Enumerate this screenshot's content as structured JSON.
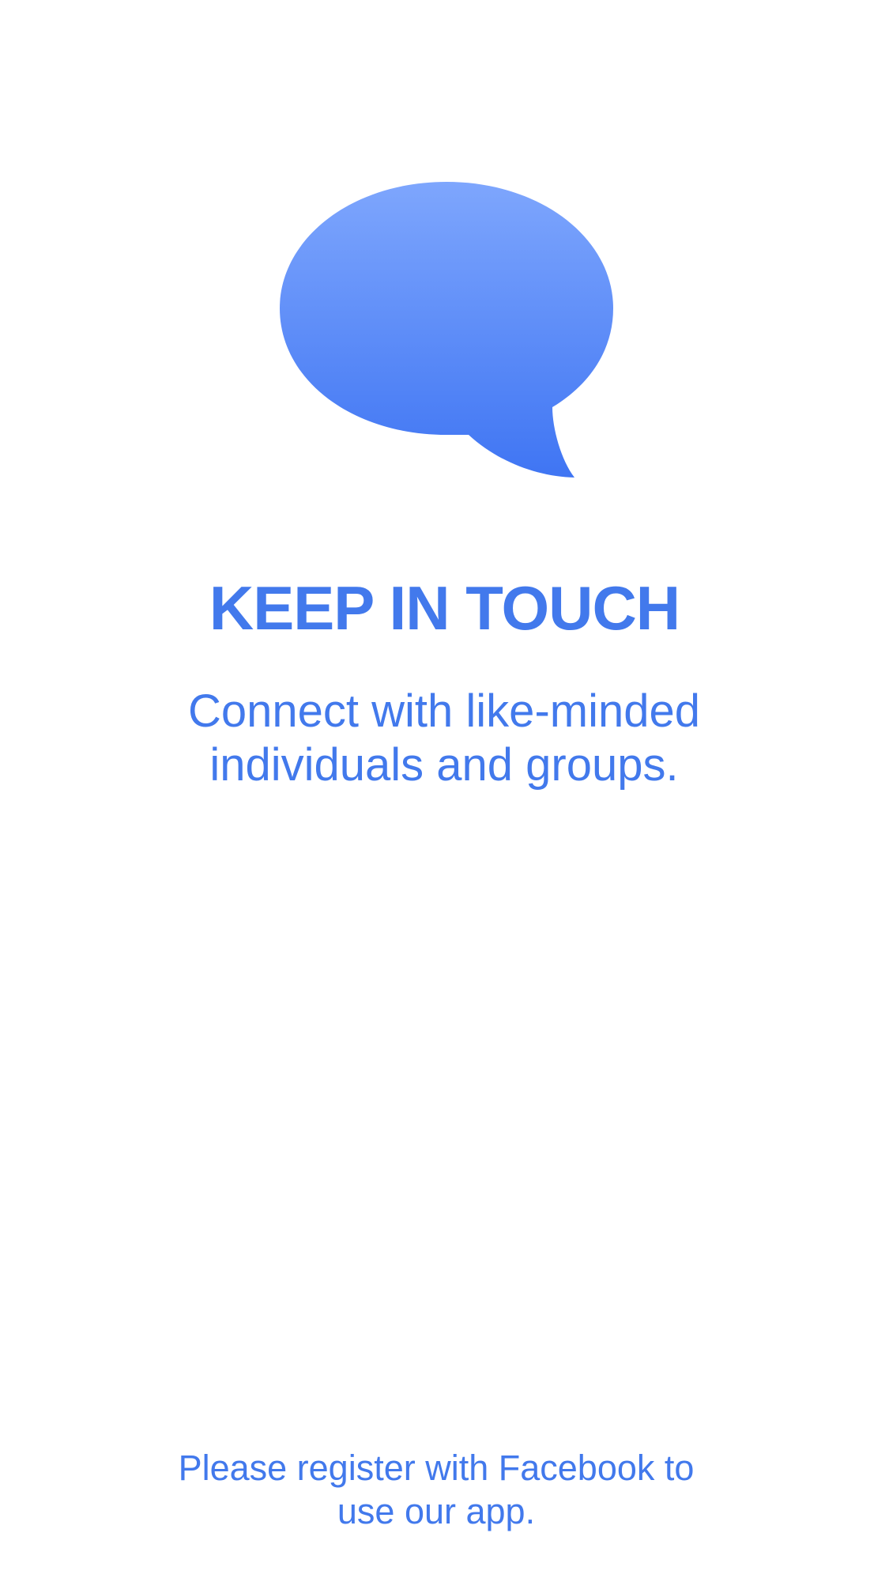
{
  "colors": {
    "accent": "#4279ec",
    "bubble_top": "#7ea6fd",
    "bubble_bottom": "#3f75f3",
    "background": "#ffffff"
  },
  "onboarding": {
    "icon": "speech-bubble-icon",
    "headline": "KEEP IN TOUCH",
    "subtitle": "Connect with like-minded individuals and groups.",
    "footer_note": "Please register with Facebook to use our app."
  }
}
